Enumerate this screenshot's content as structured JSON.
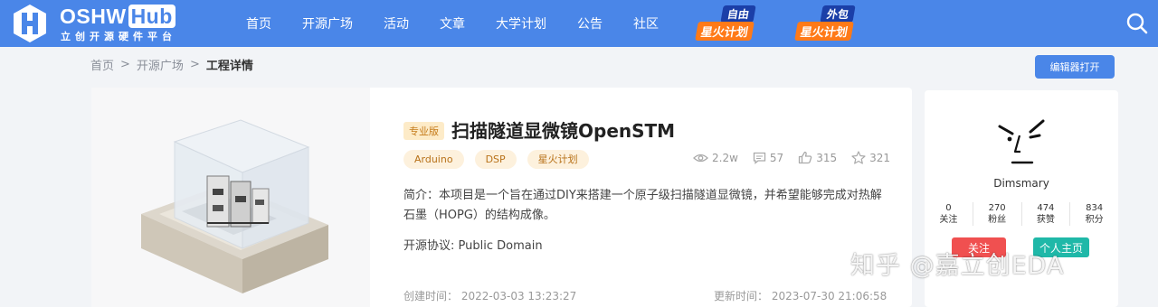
{
  "brand": {
    "name": "OSHW",
    "name_hub": "Hub",
    "subtitle": "立创开源硬件平台",
    "color": "#4a86e8"
  },
  "nav": {
    "items": [
      "首页",
      "开源广场",
      "活动",
      "文章",
      "大学计划",
      "公告",
      "社区"
    ],
    "promos": [
      {
        "top": "自由",
        "bottom": "星火计划"
      },
      {
        "top": "外包",
        "bottom": "星火计划"
      }
    ],
    "search_icon": "search-icon"
  },
  "breadcrumb": {
    "items": [
      "首页",
      "开源广场"
    ],
    "separator": ">",
    "current": "工程详情"
  },
  "actions": {
    "open_editor": "编辑器打开"
  },
  "project": {
    "badge": "专业版",
    "title": "扫描隧道显微镜OpenSTM",
    "tags": [
      "Arduino",
      "DSP",
      "星火计划"
    ],
    "stats": {
      "views": "2.2w",
      "comments": "57",
      "likes": "315",
      "favorites": "321"
    },
    "description": "简介：本项目是一个旨在通过DIY来搭建一个原子级扫描隧道显微镜，并希望能够完成对热解石墨（HOPG）的结构成像。",
    "license": "开源协议: Public Domain",
    "created_label": "创建时间：",
    "created": "2022-03-03 13:23:27",
    "updated_label": "更新时间：",
    "updated": "2023-07-30 21:06:58"
  },
  "author": {
    "name": "Dimsmary",
    "stats": [
      {
        "value": "0",
        "label": "关注"
      },
      {
        "value": "270",
        "label": "粉丝"
      },
      {
        "value": "474",
        "label": "获赞"
      },
      {
        "value": "834",
        "label": "积分"
      }
    ],
    "follow_label": "关注",
    "home_label": "个人主页"
  },
  "watermark": "知乎 @嘉立创EDA"
}
